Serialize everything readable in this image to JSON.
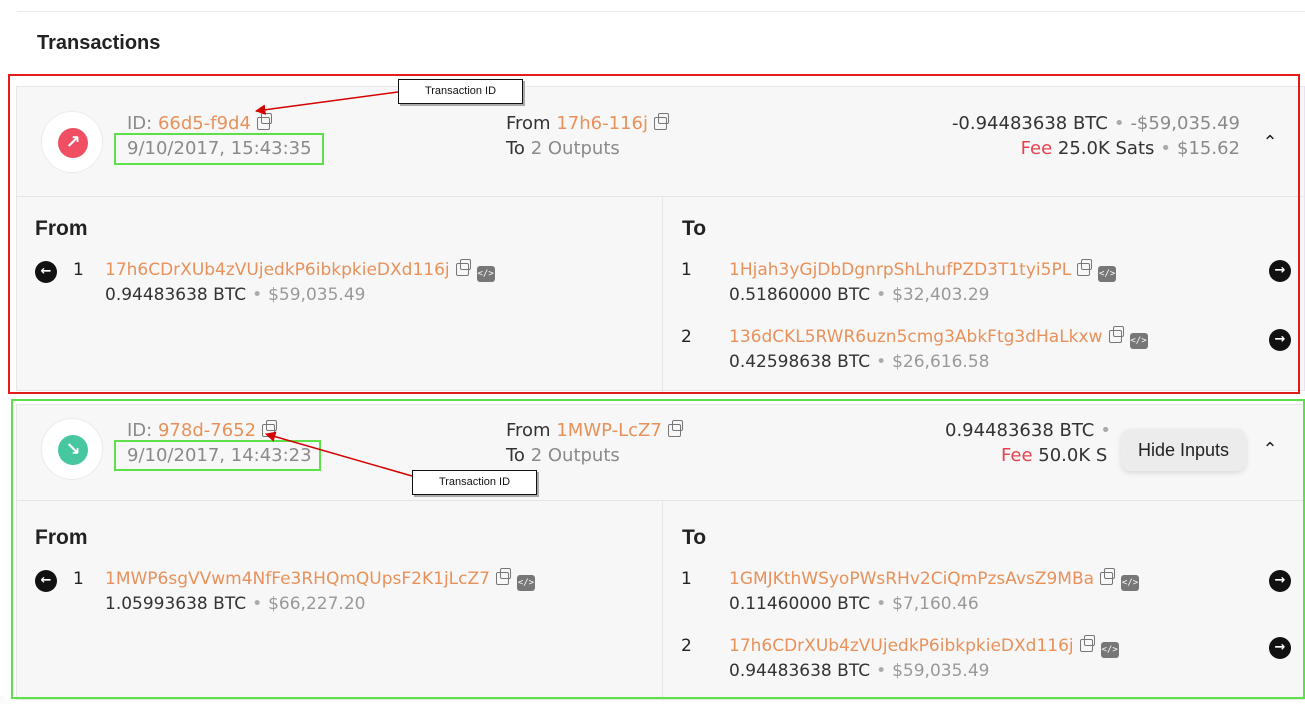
{
  "section_title": "Transactions",
  "transactions": [
    {
      "direction": "outgoing",
      "id_label": "ID:",
      "id": "66d5-f9d4",
      "datetime": "9/10/2017, 15:43:35",
      "from_label": "From",
      "from_short": "17h6-116j",
      "to_label": "To",
      "to_summary": "2 Outputs",
      "amount_btc": "-0.94483638 BTC",
      "amount_usd": "-$59,035.49",
      "fee_label": "Fee",
      "fee_sats": "25.0K Sats",
      "fee_usd": "$15.62",
      "inputs_title": "From",
      "outputs_title": "To",
      "inputs": [
        {
          "index": "1",
          "address": "17h6CDrXUb4zVUjedkP6ibkpkieDXd116j",
          "btc": "0.94483638 BTC",
          "usd": "$59,035.49"
        }
      ],
      "outputs": [
        {
          "index": "1",
          "address": "1Hjah3yGjDbDgnrpShLhufPZD3T1tyi5PL",
          "btc": "0.51860000 BTC",
          "usd": "$32,403.29"
        },
        {
          "index": "2",
          "address": "136dCKL5RWR6uzn5cmg3AbkFtg3dHaLkxw",
          "btc": "0.42598638 BTC",
          "usd": "$26,616.58"
        }
      ]
    },
    {
      "direction": "incoming",
      "id_label": "ID:",
      "id": "978d-7652",
      "datetime": "9/10/2017, 14:43:23",
      "from_label": "From",
      "from_short": "1MWP-LcZ7",
      "to_label": "To",
      "to_summary": "2 Outputs",
      "amount_btc": "0.94483638 BTC",
      "fee_label": "Fee",
      "fee_sats": "50.0K S",
      "inputs_title": "From",
      "outputs_title": "To",
      "inputs": [
        {
          "index": "1",
          "address": "1MWP6sgVVwm4NfFe3RHQmQUpsF2K1jLcZ7",
          "btc": "1.05993638 BTC",
          "usd": "$66,227.20"
        }
      ],
      "outputs": [
        {
          "index": "1",
          "address": "1GMJKthWSyoPWsRHv2CiQmPzsAvsZ9MBa",
          "btc": "0.11460000 BTC",
          "usd": "$7,160.46"
        },
        {
          "index": "2",
          "address": "17h6CDrXUb4zVUjedkP6ibkpkieDXd116j",
          "btc": "0.94483638 BTC",
          "usd": "$59,035.49"
        }
      ]
    }
  ],
  "tooltip": "Hide Inputs",
  "annotations": {
    "callout_1": "Transaction ID",
    "callout_2": "Transaction ID"
  },
  "colors": {
    "address_orange": "#e8915a",
    "fee_red": "#e8424f",
    "outgoing_red": "#ef4e63",
    "incoming_green": "#46c7a0",
    "highlight_red": "#e21b1b",
    "highlight_green": "#5ee04a"
  },
  "icons": {
    "outgoing": "arrow-up-right-icon",
    "incoming": "arrow-down-right-icon",
    "copy": "copy-icon",
    "code": "code-icon",
    "collapse": "chevron-up-icon",
    "input_arrow": "arrow-left-circle-icon",
    "output_arrow": "arrow-right-circle-icon"
  }
}
